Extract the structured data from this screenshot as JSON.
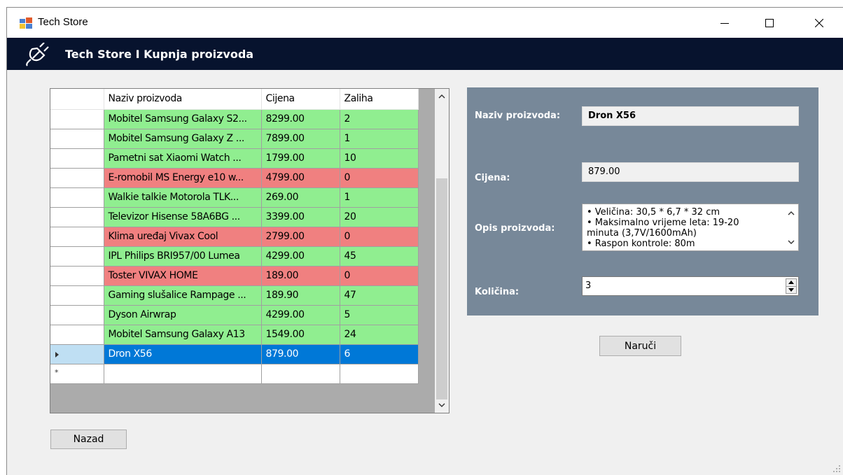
{
  "window": {
    "title": "Tech Store"
  },
  "header": {
    "title": "Tech Store I Kupnja proizvoda"
  },
  "grid": {
    "columns": [
      "Naziv proizvoda",
      "Cijena",
      "Zaliha"
    ],
    "rows": [
      {
        "name": "Mobitel Samsung Galaxy S2...",
        "price": "8299.00",
        "stock": "2",
        "state": "green"
      },
      {
        "name": "Mobitel Samsung Galaxy Z ...",
        "price": "7899.00",
        "stock": "1",
        "state": "green"
      },
      {
        "name": "Pametni sat Xiaomi Watch ...",
        "price": "1799.00",
        "stock": "10",
        "state": "green"
      },
      {
        "name": "E-romobil MS Energy e10 w...",
        "price": "4799.00",
        "stock": "0",
        "state": "red"
      },
      {
        "name": "Walkie talkie Motorola TLK...",
        "price": "269.00",
        "stock": "1",
        "state": "green"
      },
      {
        "name": "Televizor Hisense 58A6BG ...",
        "price": "3399.00",
        "stock": "20",
        "state": "green"
      },
      {
        "name": "Klima uređaj Vivax Cool",
        "price": "2799.00",
        "stock": "0",
        "state": "red"
      },
      {
        "name": "IPL Philips BRI957/00 Lumea",
        "price": "4299.00",
        "stock": "45",
        "state": "green"
      },
      {
        "name": "Toster VIVAX HOME",
        "price": "189.00",
        "stock": "0",
        "state": "red"
      },
      {
        "name": "Gaming slušalice Rampage ...",
        "price": "189.90",
        "stock": "47",
        "state": "green"
      },
      {
        "name": "Dyson Airwrap",
        "price": "4299.00",
        "stock": "5",
        "state": "green"
      },
      {
        "name": "Mobitel Samsung Galaxy A13",
        "price": "1549.00",
        "stock": "24",
        "state": "green"
      },
      {
        "name": "Dron X56",
        "price": "879.00",
        "stock": "6",
        "state": "selected"
      }
    ]
  },
  "details": {
    "name_label": "Naziv proizvoda:",
    "name_value": "Dron X56",
    "price_label": "Cijena:",
    "price_value": "879.00",
    "desc_label": "Opis proizvoda:",
    "desc_lines": [
      "• Veličina: 30,5 * 6,7 * 32 cm",
      "• Maksimalno vrijeme leta: 19-20",
      "minuta (3,7V/1600mAh)",
      "• Raspon kontrole: 80m"
    ],
    "qty_label": "Količina:",
    "qty_value": "3"
  },
  "buttons": {
    "order": "Naruči",
    "back": "Nazad"
  },
  "colors": {
    "header": "#07132e",
    "in_stock": "#90ee90",
    "out_of_stock": "#f08080",
    "selected": "#0078d7",
    "panel": "#778899"
  }
}
